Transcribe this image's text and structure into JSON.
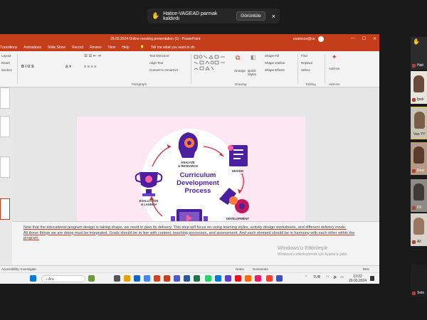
{
  "notification": {
    "text": "Hatice-VAGEAD parmak kaldırdı",
    "button": "Görüntüle"
  },
  "titlebar": {
    "title": "29.03.2024 Online meeting presentation (1) - PowerPoint",
    "user": "esamsoo@ce"
  },
  "menu": [
    "Transitions",
    "Animations",
    "Slide Show",
    "Record",
    "Review",
    "View",
    "Help"
  ],
  "tell_me": "Tell me what you want to do",
  "ribbon": {
    "layout": "Layout",
    "reset": "Reset",
    "section": "Section",
    "paragraph_items": [
      "Text Direction",
      "Align Text",
      "Convert to SmartArt"
    ],
    "paragraph": "Paragraph",
    "drawing": "Drawing",
    "arrange": "Arrange",
    "quick_styles": "Quick Styles",
    "shape_fill": "Shape Fill",
    "shape_outline": "Shape Outline",
    "shape_effects": "Shape Effects",
    "find": "Find",
    "replace": "Replace",
    "select": "Select",
    "editing": "Editing",
    "addins": "Add-ins",
    "addins_group": "Add-ins"
  },
  "slide": {
    "center_title": "Curriculum\nDevelopment\nProcess",
    "steps": [
      {
        "label": "ANALYZE\n& RESEARCH"
      },
      {
        "label": "DESIGN"
      },
      {
        "label": "DEVELOPMENT"
      },
      {
        "label": "IMPLEMENTATION"
      },
      {
        "label": "EVALUATION\n& LAUNCH"
      }
    ]
  },
  "notes": {
    "line1": "Now that the educational program design is taking shape, we need to plan its delivery. This step will focus on using learning styles, activity design worksheets, and different delivery mode.",
    "line2": "All these things we are doing must be integrated. Goals should be in line with content, teaching processes, and assessment. And each element should be in harmony with each other within the program."
  },
  "watermark": {
    "line1": "Windows'u Etkinleştir",
    "line2": "Windows'u etkinleştirmek için Ayarlar'a gidin."
  },
  "status": {
    "accessibility": "Accessibility: Investigate",
    "notes": "Notes",
    "comments": "Comments",
    "zoom": "56%"
  },
  "taskbar": {
    "search": "Ara",
    "lang": "TUR",
    "time": "13:22",
    "date": "29.03.2024"
  },
  "participants": [
    "Hati",
    "İpek",
    "Van YY",
    "Rezi",
    "Dil",
    "Ali",
    "Sele"
  ],
  "colors": {
    "ppt_accent": "#c43e1c",
    "slide_bg": "#fde7f3",
    "title_purple": "#4b1fa0"
  }
}
